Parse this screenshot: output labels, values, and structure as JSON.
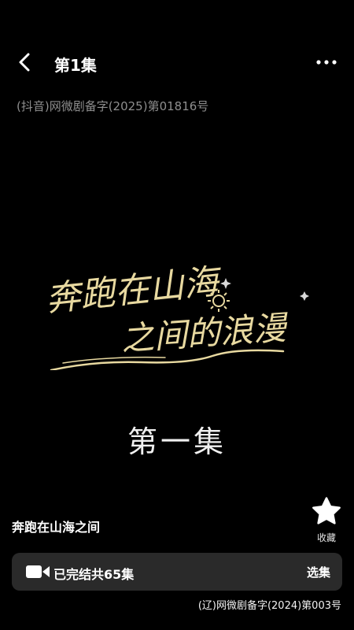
{
  "header": {
    "episode_title": "第1集",
    "back_icon": "chevron-left-icon",
    "more_icon": "more-horizontal-icon"
  },
  "license_top": "(抖音)网微剧备字(2025)第01816号",
  "video": {
    "title_art_line1": "奔跑在山海",
    "title_art_line2": "之间的浪漫",
    "episode_card": "第一集"
  },
  "drama": {
    "name": "奔跑在山海之间"
  },
  "favorite": {
    "icon": "star-icon",
    "label": "收藏"
  },
  "series_bar": {
    "icon": "video-camera-icon",
    "status": "已完结共65集",
    "select_label": "选集"
  },
  "license_bottom": "(辽)网微剧备字(2024)第003号",
  "colors": {
    "background": "#000000",
    "title_art_gold": "#e8d9a0",
    "bar_background": "#2a2a2a",
    "muted_text": "#8e8e8e"
  }
}
